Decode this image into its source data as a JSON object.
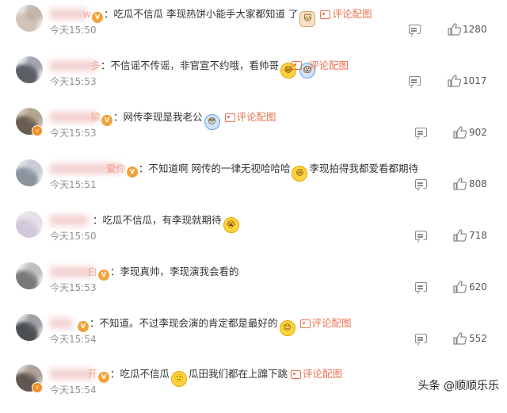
{
  "comments": [
    {
      "name_tail": "w",
      "text": "：吃瓜不信瓜 李现热饼小能手大家都知道 了",
      "emoji": "cat-icon",
      "has_pic": true,
      "pic_label": "评论配图",
      "time": "今天15:50",
      "likes": "1280"
    },
    {
      "name_tail": "多",
      "text": "：不信谣不传谣，非官宣不约哦，看帅哥",
      "emoji": "crying-laugh-icon",
      "emoji2": "shocked-icon",
      "has_pic": true,
      "pic_label": "评论配图",
      "time": "今天15:53",
      "likes": "1017"
    },
    {
      "name_tail": "猿",
      "text": "：网传李现是我老公",
      "emoji": "shy-face-icon",
      "has_pic": true,
      "pic_label": "评论配图",
      "time": "今天15:53",
      "likes": "902"
    },
    {
      "name_tail": "爱你",
      "text": "：不知道啊 网传的一律无视哈哈哈",
      "emoji": "grin-face-icon",
      "text2": "李现拍得我都爱看都期待",
      "has_pic": false,
      "time": "今天15:51",
      "likes": "808"
    },
    {
      "name_tail": "",
      "text": "：吃瓜不信瓜，有李现就期待",
      "emoji": "crying-face-icon",
      "has_pic": false,
      "time": "今天15:50",
      "likes": "718"
    },
    {
      "name_tail": "白",
      "text": "：李现真帅，李现演我会看的",
      "has_pic": false,
      "time": "今天15:53",
      "likes": "620"
    },
    {
      "name_tail": "",
      "text": "：不知道。不过李现会演的肯定都是最好的",
      "emoji": "happy-face-icon",
      "has_pic": true,
      "pic_label": "评论配图",
      "time": "今天15:54",
      "likes": "552"
    },
    {
      "name_tail": "开",
      "text": "：吃瓜不信瓜",
      "emoji": "smile-face-icon",
      "text2": "瓜田我们都在上蹿下跳",
      "has_pic": true,
      "pic_label": "评论配图",
      "time": "今天15:54",
      "likes": ""
    }
  ],
  "watermark": "头条 @顺顺乐乐",
  "colors": {
    "link": "#eb7350",
    "time": "#939393",
    "vip_badge": "#f2a33a"
  }
}
